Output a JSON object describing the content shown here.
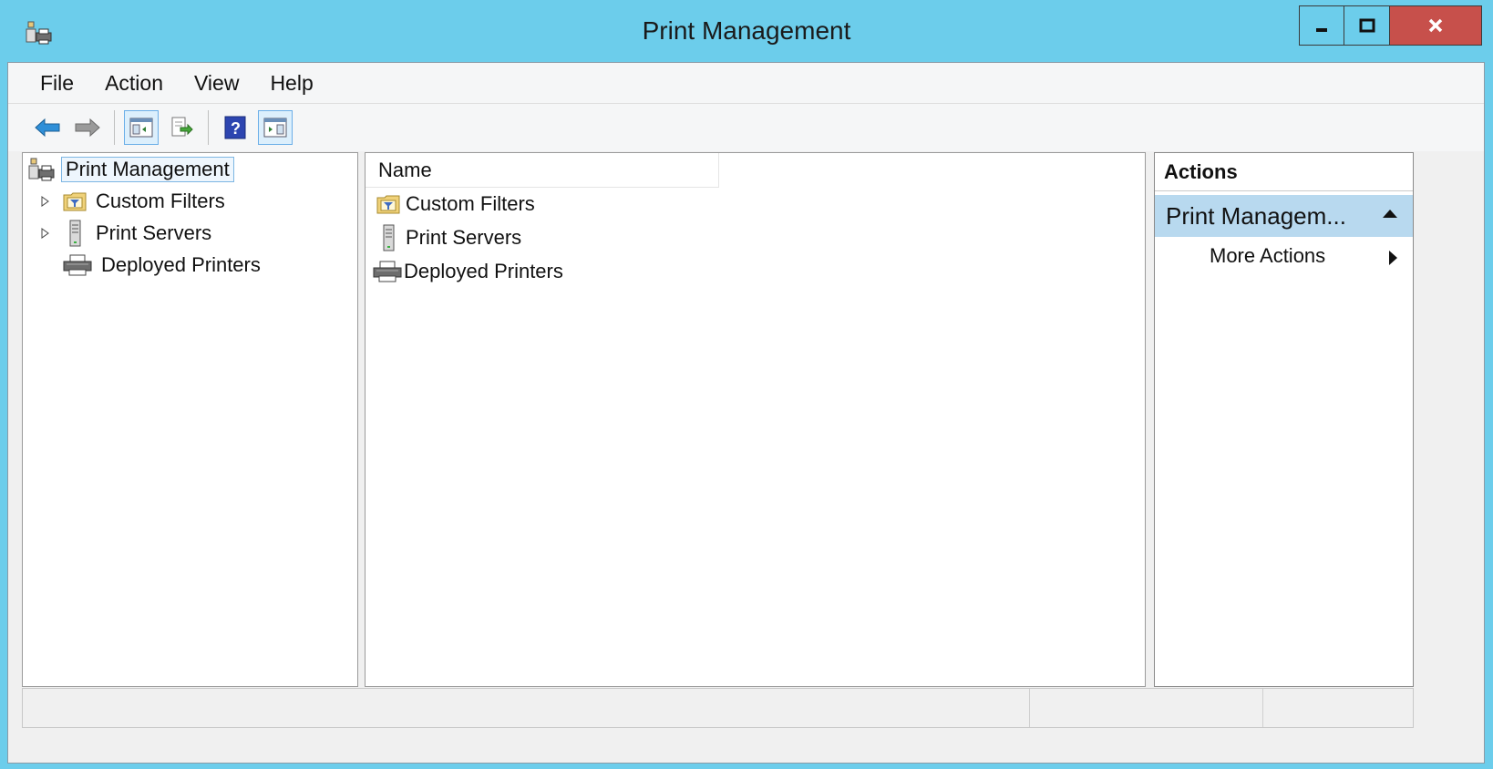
{
  "window": {
    "title": "Print Management"
  },
  "menu": [
    "File",
    "Action",
    "View",
    "Help"
  ],
  "tree": {
    "root": "Print Management",
    "items": [
      {
        "label": "Custom Filters",
        "icon": "filter-folder-icon",
        "expandable": true
      },
      {
        "label": "Print Servers",
        "icon": "server-icon",
        "expandable": true
      },
      {
        "label": "Deployed Printers",
        "icon": "printer-icon",
        "expandable": false
      }
    ]
  },
  "list": {
    "column_header": "Name",
    "items": [
      {
        "label": "Custom Filters",
        "icon": "filter-folder-icon"
      },
      {
        "label": "Print Servers",
        "icon": "server-icon"
      },
      {
        "label": "Deployed Printers",
        "icon": "printer-icon"
      }
    ]
  },
  "actions": {
    "title": "Actions",
    "section": "Print Managem...",
    "more_actions": "More Actions"
  },
  "colors": {
    "titlebar": "#6ccdeb",
    "close": "#c7504b",
    "section_highlight": "#b8d9ef"
  }
}
